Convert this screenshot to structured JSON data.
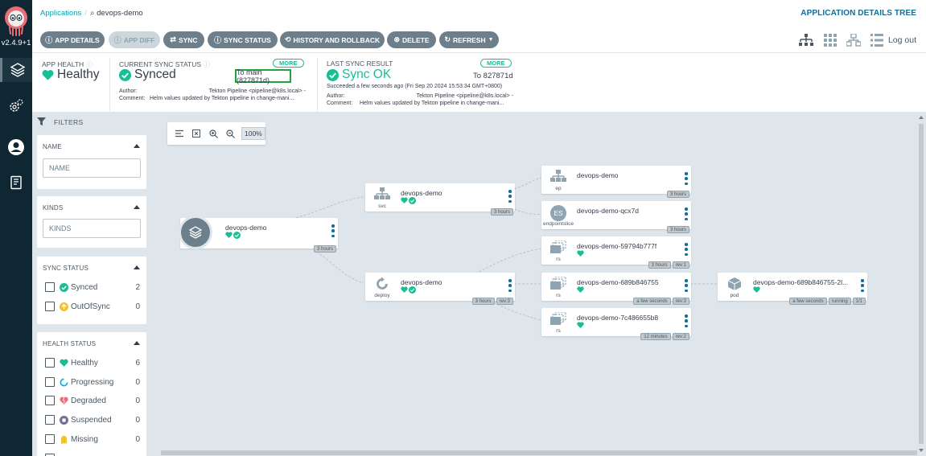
{
  "nav": {
    "version": "v2.4.9+1",
    "items": [
      {
        "name": "applications",
        "icon": "layers-icon"
      },
      {
        "name": "settings",
        "icon": "gear-icon"
      },
      {
        "name": "user-info",
        "icon": "user-icon"
      },
      {
        "name": "documentation",
        "icon": "docs-icon"
      }
    ]
  },
  "breadcrumb": {
    "parent": "Applications",
    "current": "devops-demo"
  },
  "view_title": "APPLICATION DETAILS TREE",
  "toolbar": {
    "buttons": [
      {
        "label": "APP DETAILS",
        "icon": "info-icon"
      },
      {
        "label": "APP DIFF",
        "icon": "info-icon",
        "disabled": true
      },
      {
        "label": "SYNC",
        "icon": "sync-icon"
      },
      {
        "label": "SYNC STATUS",
        "icon": "info-icon"
      },
      {
        "label": "HISTORY AND ROLLBACK",
        "icon": "history-icon"
      },
      {
        "label": "DELETE",
        "icon": "delete-icon"
      },
      {
        "label": "REFRESH",
        "icon": "refresh-icon"
      }
    ],
    "logout_label": "Log out"
  },
  "status": {
    "app_health": {
      "label": "APP HEALTH",
      "value": "Healthy"
    },
    "sync_status": {
      "label": "CURRENT SYNC STATUS",
      "value": "Synced",
      "more": "MORE",
      "target": "To main (827871d)",
      "author_label": "Author:",
      "author": "Tekton Pipeline <pipeline@k8s.local> -",
      "comment_label": "Comment:",
      "comment": "Helm values updated by Tekton pipeline in change-mani..."
    },
    "last_sync": {
      "label": "LAST SYNC RESULT",
      "value": "Sync OK",
      "more": "MORE",
      "target": "To 827871d",
      "detail": "Succeeded a few seconds ago (Fri Sep 20 2024 15:53:34 GMT+0800)",
      "author_label": "Author:",
      "author": "Tekton Pipeline <pipeline@k8s.local> -",
      "comment_label": "Comment:",
      "comment": "Helm values updated by Tekton pipeline in change-mani..."
    }
  },
  "filters": {
    "title": "FILTERS",
    "name": {
      "title": "NAME",
      "placeholder": "NAME"
    },
    "kinds": {
      "title": "KINDS",
      "placeholder": "KINDS"
    },
    "sync_status": {
      "title": "SYNC STATUS",
      "items": [
        {
          "label": "Synced",
          "count": "2"
        },
        {
          "label": "OutOfSync",
          "count": "0"
        }
      ]
    },
    "health_status": {
      "title": "HEALTH STATUS",
      "items": [
        {
          "label": "Healthy",
          "count": "6"
        },
        {
          "label": "Progressing",
          "count": "0"
        },
        {
          "label": "Degraded",
          "count": "0"
        },
        {
          "label": "Suspended",
          "count": "0"
        },
        {
          "label": "Missing",
          "count": "0"
        }
      ]
    }
  },
  "zoom": {
    "level": "100%"
  },
  "tree": {
    "nodes": [
      {
        "id": "app",
        "name": "devops-demo",
        "kind": "",
        "tags": [
          "3 hours"
        ]
      },
      {
        "id": "svc",
        "name": "devops-demo",
        "kind": "svc",
        "tags": [
          "3 hours"
        ]
      },
      {
        "id": "deploy",
        "name": "devops-demo",
        "kind": "deploy",
        "tags": [
          "3 hours",
          "rev:3"
        ]
      },
      {
        "id": "ep",
        "name": "devops-demo",
        "kind": "ep",
        "tags": [
          "3 hours"
        ]
      },
      {
        "id": "eps",
        "name": "devops-demo-qcx7d",
        "kind": "endpointslice",
        "icon_text": "ES",
        "tags": [
          "3 hours"
        ]
      },
      {
        "id": "rs1",
        "name": "devops-demo-59794b777f",
        "kind": "rs",
        "tags": [
          "3 hours",
          "rev:1"
        ]
      },
      {
        "id": "rs2",
        "name": "devops-demo-689b846755",
        "kind": "rs",
        "tags": [
          "a few seconds",
          "rev:3"
        ]
      },
      {
        "id": "rs3",
        "name": "devops-demo-7c486655b8",
        "kind": "rs",
        "tags": [
          "12 minutes",
          "rev:2"
        ]
      },
      {
        "id": "pod",
        "name": "devops-demo-689b846755-2l...",
        "kind": "pod",
        "tags": [
          "a few seconds",
          "running",
          "1/1"
        ]
      }
    ]
  },
  "colors": {
    "healthy": "#18be94",
    "accent": "#00a2b3",
    "nav_bg": "#0f2733",
    "button": "#6d7f8b",
    "canvas": "#dee6eb"
  }
}
